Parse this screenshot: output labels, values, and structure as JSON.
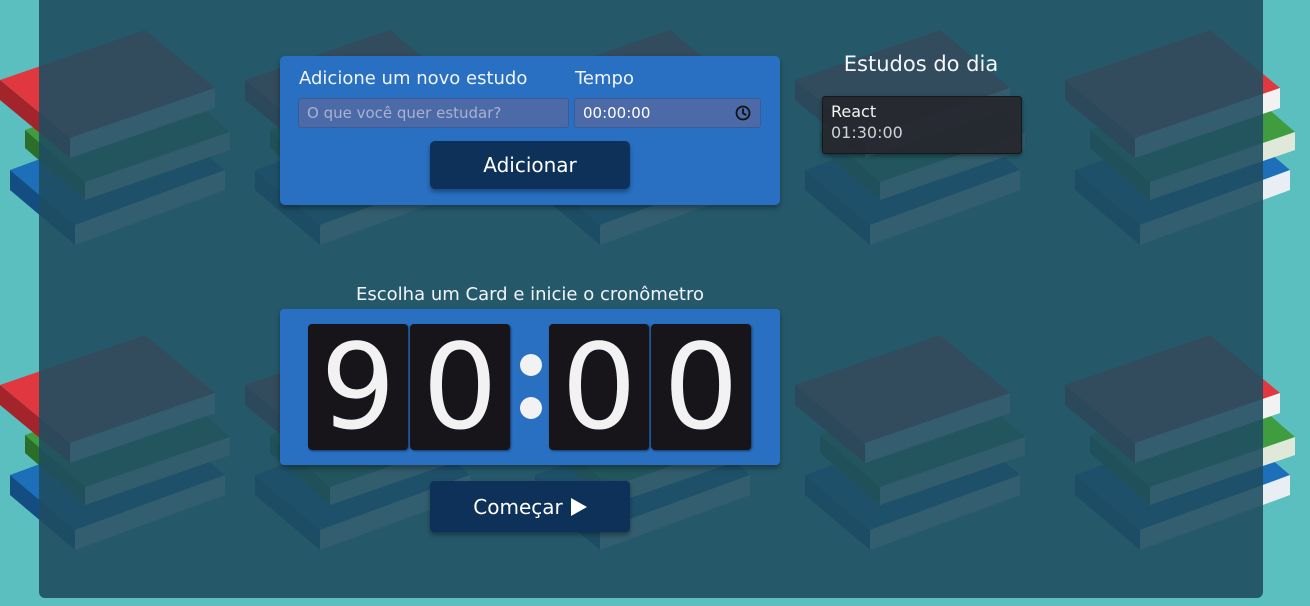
{
  "form": {
    "study_label": "Adicione um novo estudo",
    "time_label": "Tempo",
    "study_placeholder": "O que você quer estudar?",
    "time_value": "00:00:00",
    "add_button": "Adicionar"
  },
  "study_list": {
    "title": "Estudos do dia",
    "items": [
      {
        "name": "React",
        "time": "01:30:00"
      }
    ]
  },
  "timer": {
    "title": "Escolha um Card e inicie o cronômetro",
    "digits": [
      "9",
      "0",
      "0",
      "0"
    ],
    "start_button": "Começar"
  },
  "icons": {
    "time_input": "clock-icon",
    "start_button": "play-icon",
    "background": "books-icon"
  },
  "colors": {
    "page_background": "#5bbfbf",
    "app_background": "#1f4e61",
    "card_blue": "#2970c2",
    "button_navy": "#0d3158",
    "digit_background": "#17151a"
  }
}
